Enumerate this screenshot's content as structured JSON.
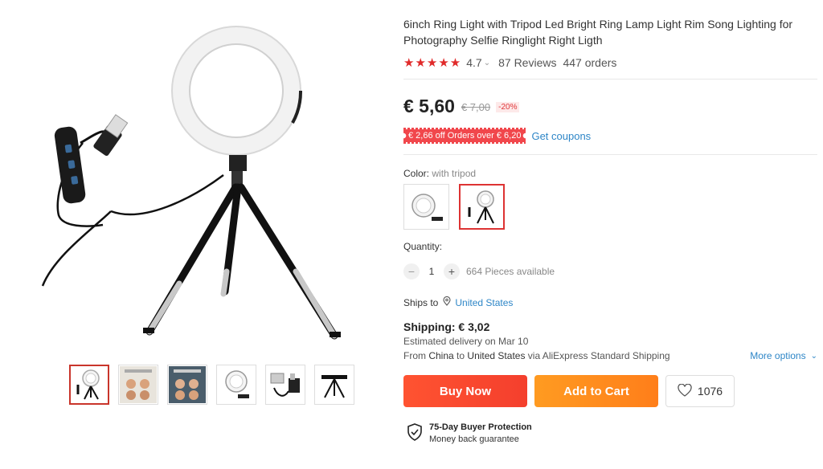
{
  "product": {
    "title": "6inch Ring Light with Tripod Led Bright Ring Lamp Light Rim Song Lighting for Photography Selfie Ringlight Right Ligth",
    "rating_stars": "★★★★★",
    "rating_value": "4.7",
    "reviews": "87 Reviews",
    "orders": "447 orders"
  },
  "price": {
    "current": "€ 5,60",
    "original": "€ 7,00",
    "discount": "-20%"
  },
  "coupon": {
    "label": "€ 2,66 off Orders over € 6,20",
    "link": "Get coupons"
  },
  "color": {
    "label": "Color:",
    "value": "with tripod"
  },
  "quantity": {
    "label": "Quantity:",
    "value": "1",
    "available": "664 Pieces available"
  },
  "shipping": {
    "ships_to_label": "Ships to",
    "ships_to_country": "United States",
    "cost": "Shipping: € 3,02",
    "delivery": "Estimated delivery on Mar 10",
    "from_prefix": "From",
    "from_country": "China",
    "to_word": "to",
    "to_country": "United States",
    "via": "via AliExpress Standard Shipping",
    "more_options": "More options"
  },
  "actions": {
    "buy_now": "Buy Now",
    "add_to_cart": "Add to Cart",
    "wishlist_count": "1076"
  },
  "protection": {
    "title": "75-Day Buyer Protection",
    "subtitle": "Money back guarantee"
  },
  "icons": {
    "star": "star-icon",
    "location": "location-pin-icon",
    "heart": "heart-icon",
    "shield": "shield-check-icon"
  },
  "colors": {
    "accent_red": "#e02a2a",
    "buy_now": "#f43f2d",
    "add_to_cart": "#ff8a1d",
    "link_blue": "#2e86c7"
  }
}
